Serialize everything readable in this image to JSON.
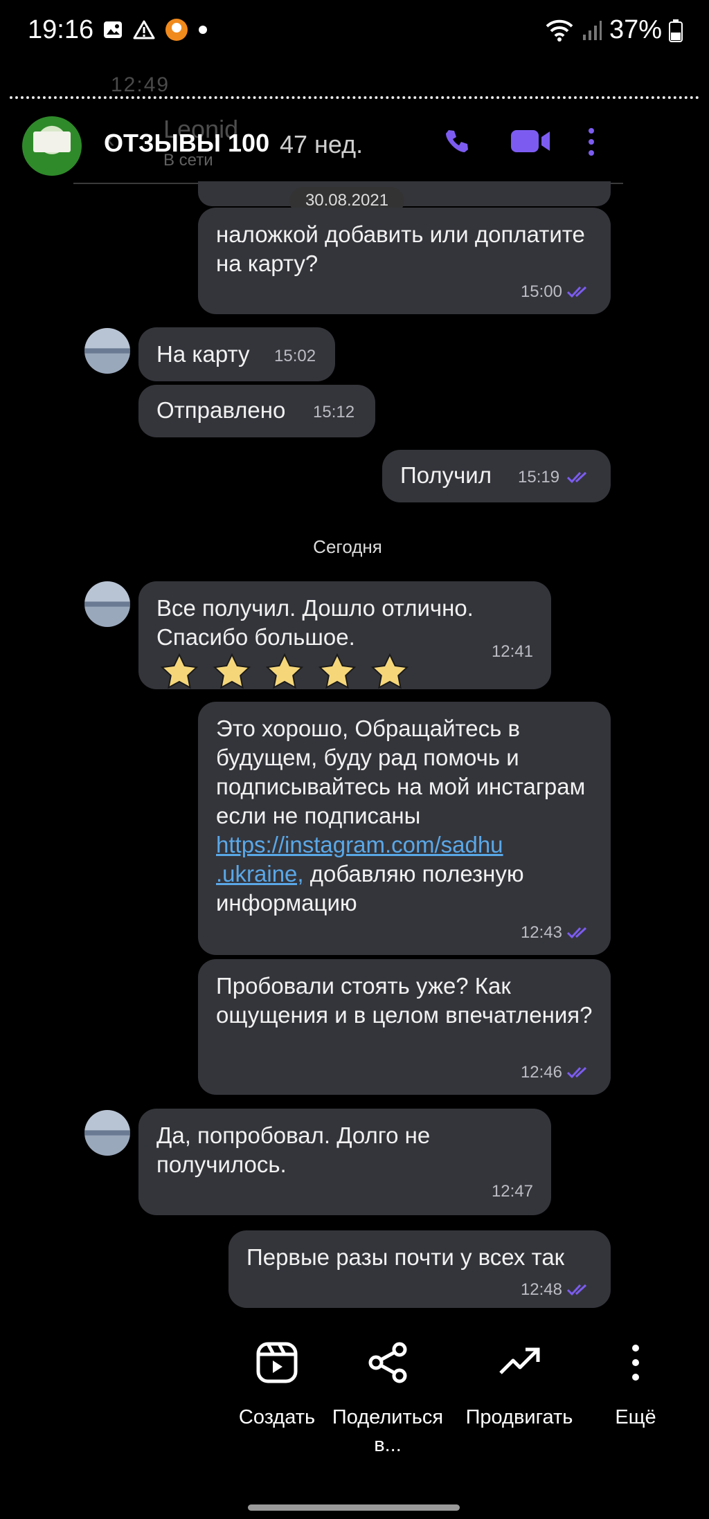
{
  "status_bar": {
    "time": "19:16",
    "battery": "37%",
    "ghost_status": "12:49"
  },
  "story": {
    "title": "ОТЗЫВЫ 100",
    "posted_ago": "47 нед.",
    "ghost_contact_name": "Leonid",
    "ghost_contact_status": "В сети"
  },
  "chat": {
    "date_chip": "30.08.2021",
    "today_label": "Сегодня",
    "messages": [
      {
        "side": "out",
        "text": "наложкой добавить или доплатите на карту?",
        "time": "15:00"
      },
      {
        "side": "in",
        "text": "На карту",
        "time": "15:02"
      },
      {
        "side": "in",
        "text": "Отправлено",
        "time": "15:12"
      },
      {
        "side": "out",
        "text": "Получил",
        "time": "15:19"
      },
      {
        "side": "in",
        "text": "Все получил. Дошло отлично. Спасибо большое.",
        "time": "12:41",
        "rating_stars": 5
      },
      {
        "side": "out",
        "text_before": "Это хорошо, Обращайтесь в будущем, буду рад помочь и подписывайтесь на мой инстаграм если не подписаны ",
        "link_line1": "https://instagram.com/sadhu",
        "link_line2": ".ukraine,",
        "text_after": " добавляю полезную информацию",
        "time": "12:43"
      },
      {
        "side": "out",
        "text": "Пробовали стоять уже? Как ощущения и в целом впечатления?",
        "time": "12:46"
      },
      {
        "side": "in",
        "text": "Да, попробовал. Долго не получилось.",
        "time": "12:47"
      },
      {
        "side": "out",
        "text": "Первые разы почти у всех так",
        "time": "12:48"
      }
    ]
  },
  "actions": {
    "create": "Создать",
    "share": "Поделиться в...",
    "promote": "Продвигать",
    "more": "Ещё"
  },
  "colors": {
    "bubble": "#34353b",
    "accent_purple": "#7c5cf0",
    "link": "#5aa8e8",
    "star": "#f5d77a"
  }
}
